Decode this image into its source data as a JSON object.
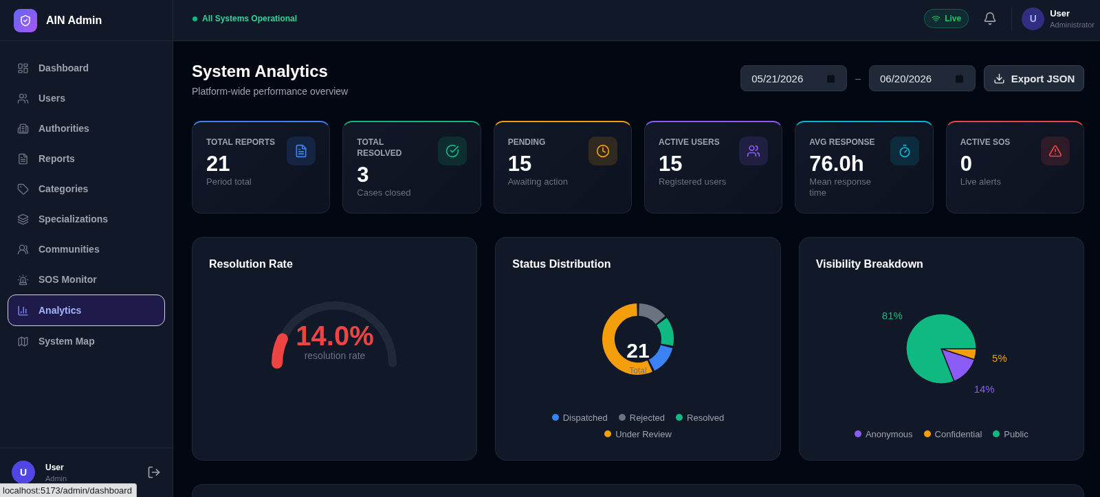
{
  "sidebar": {
    "brand": "AIN Admin",
    "items": [
      {
        "label": "Dashboard",
        "selected": false
      },
      {
        "label": "Users",
        "selected": false
      },
      {
        "label": "Authorities",
        "selected": false
      },
      {
        "label": "Reports",
        "selected": false
      },
      {
        "label": "Categories",
        "selected": false
      },
      {
        "label": "Specializations",
        "selected": false
      },
      {
        "label": "Communities",
        "selected": false
      },
      {
        "label": "SOS Monitor",
        "selected": false
      },
      {
        "label": "Analytics",
        "selected": true
      },
      {
        "label": "System Map",
        "selected": false
      }
    ],
    "user": {
      "initial": "U",
      "name": "User",
      "role": "Admin"
    }
  },
  "header": {
    "status": "All Systems Operational",
    "live": "Live",
    "user": {
      "initial": "U",
      "name": "User",
      "role": "Administrator"
    }
  },
  "page": {
    "title": "System Analytics",
    "subtitle": "Platform-wide performance overview",
    "date_from": "05/21/2026",
    "separator": "–",
    "date_to": "06/20/2026",
    "export_button": "Export JSON"
  },
  "stats": [
    {
      "label": "TOTAL REPORTS",
      "value": "21",
      "caption": "Period total",
      "color": "#3b82f6"
    },
    {
      "label": "TOTAL RESOLVED",
      "value": "3",
      "caption": "Cases closed",
      "color": "#10b981"
    },
    {
      "label": "PENDING",
      "value": "15",
      "caption": "Awaiting action",
      "color": "#f59e0b"
    },
    {
      "label": "ACTIVE USERS",
      "value": "15",
      "caption": "Registered users",
      "color": "#8b5cf6"
    },
    {
      "label": "AVG RESPONSE",
      "value": "76.0h",
      "caption": "Mean response time",
      "color": "#06b6d4"
    },
    {
      "label": "ACTIVE SOS",
      "value": "0",
      "caption": "Live alerts",
      "color": "#ef4444"
    }
  ],
  "charts": {
    "resolution": {
      "title": "Resolution Rate",
      "value": "14.0%",
      "caption": "resolution rate",
      "level": 0.14
    },
    "status": {
      "title": "Status Distribution",
      "total": "21",
      "total_label": "Total",
      "legend": [
        {
          "label": "Dispatched",
          "color": "#3b82f6"
        },
        {
          "label": "Rejected",
          "color": "#6b7280"
        },
        {
          "label": "Resolved",
          "color": "#10b981"
        },
        {
          "label": "Under Review",
          "color": "#f59e0b"
        }
      ]
    },
    "visibility": {
      "chart_data": {
        "type": "pie",
        "title": "Visibility Breakdown",
        "categories": [
          "Anonymous",
          "Confidential",
          "Public"
        ],
        "values": [
          14,
          5,
          81
        ],
        "colors": [
          "#8b5cf6",
          "#f59e0b",
          "#10b981"
        ],
        "value_labels": [
          "14%",
          "5%",
          "81%"
        ]
      }
    }
  },
  "status_url": "localhost:5173/admin/dashboard"
}
